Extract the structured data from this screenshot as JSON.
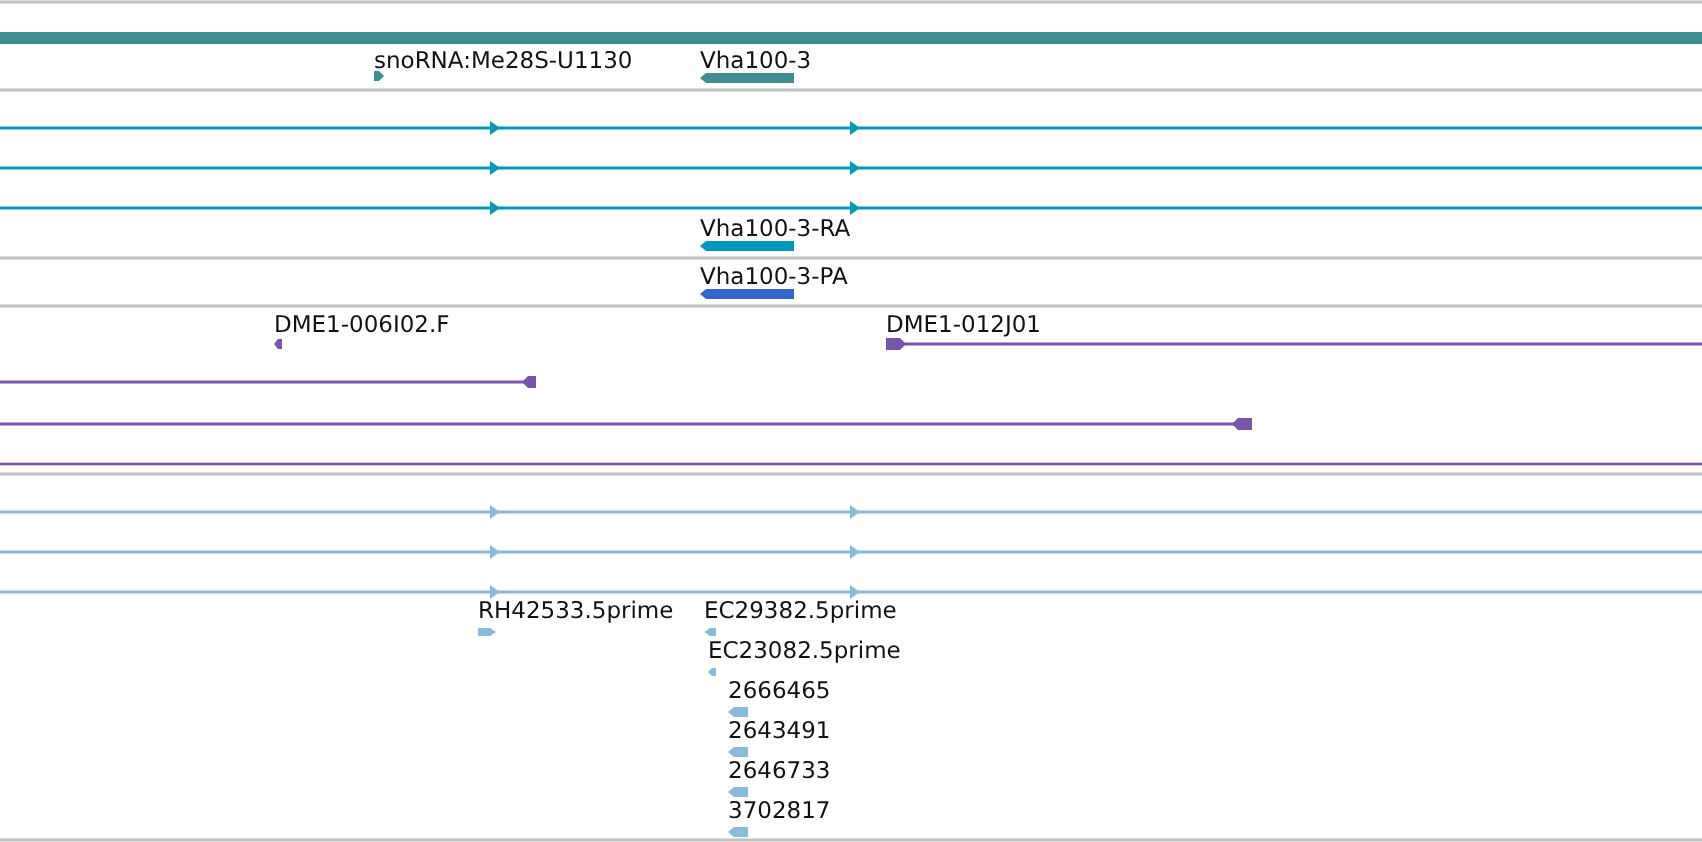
{
  "tracks": [
    {
      "color": "#3f8f8f",
      "features": [
        {
          "kind": "bar"
        },
        {
          "kind": "block",
          "label": "snoRNA:Me28S-U1130",
          "reverse": false
        },
        {
          "kind": "block",
          "label": "Vha100-3",
          "reverse": true
        }
      ]
    },
    {
      "color": "#0099bb",
      "features": [
        {
          "kind": "line",
          "reverse": false
        },
        {
          "kind": "line",
          "reverse": false
        },
        {
          "kind": "line",
          "reverse": false
        },
        {
          "kind": "block",
          "label": "Vha100-3-RA",
          "reverse": true
        }
      ]
    },
    {
      "color": "#3366cc",
      "features": [
        {
          "kind": "block",
          "label": "Vha100-3-PA",
          "reverse": true
        }
      ]
    },
    {
      "color": "#7755aa",
      "features": [
        {
          "kind": "block",
          "label": "DME1-006I02.F",
          "reverse": true
        },
        {
          "kind": "line",
          "label": "DME1-012J01",
          "reverse": false
        },
        {
          "kind": "line",
          "reverse": true
        },
        {
          "kind": "line",
          "reverse": true
        },
        {
          "kind": "bar"
        }
      ]
    },
    {
      "color": "#88bbdd",
      "features": [
        {
          "kind": "line",
          "reverse": false
        },
        {
          "kind": "line",
          "reverse": false
        },
        {
          "kind": "line",
          "reverse": false
        },
        {
          "kind": "block",
          "label": "RH42533.5prime",
          "reverse": false
        },
        {
          "kind": "block",
          "label": "EC29382.5prime",
          "reverse": true
        },
        {
          "kind": "block",
          "label": "EC23082.5prime",
          "reverse": true
        },
        {
          "kind": "block",
          "label": "2666465",
          "reverse": true
        },
        {
          "kind": "block",
          "label": "2643491",
          "reverse": true
        },
        {
          "kind": "block",
          "label": "2646733",
          "reverse": true
        },
        {
          "kind": "block",
          "label": "3702817",
          "reverse": true
        }
      ]
    }
  ]
}
